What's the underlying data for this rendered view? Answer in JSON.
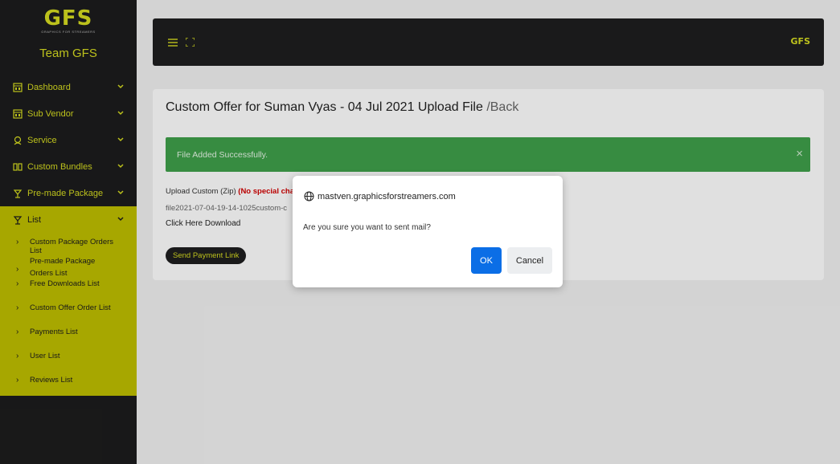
{
  "sidebar": {
    "logo_text": "GFS",
    "logo_subtext": "GRAPHICS FOR STREAMERS",
    "team_name": "Team GFS",
    "menu": [
      {
        "label": "Dashboard",
        "icon": "dashboard-icon"
      },
      {
        "label": "Sub Vendor",
        "icon": "sub-vendor-icon"
      },
      {
        "label": "Service",
        "icon": "service-icon"
      },
      {
        "label": "Custom Bundles",
        "icon": "bundles-icon"
      },
      {
        "label": "Pre-made Package",
        "icon": "package-icon"
      },
      {
        "label": "List",
        "icon": "list-icon"
      }
    ],
    "submenu": [
      "Custom Package Orders List",
      "Pre-made Package Orders List",
      "Free Downloads List",
      "Custom Offer Order List",
      "Payments List",
      "User List",
      "Reviews List"
    ]
  },
  "topbar": {
    "logo_text": "GFS"
  },
  "card": {
    "title": "Custom Offer for Suman Vyas - 04 Jul 2021 Upload File",
    "back_label": "/Back",
    "alert_message": "File Added Successfully.",
    "alert_close": "×",
    "upload_label": "Upload Custom (Zip)",
    "upload_warning": "(No special char",
    "file_name": "file2021-07-04-19-14-1025custom-c",
    "download_link": "Click Here Download",
    "send_button": "Send Payment Link"
  },
  "dialog": {
    "origin": "mastven.graphicsforstreamers.com",
    "message": "Are you sure you want to sent mail?",
    "ok_label": "OK",
    "cancel_label": "Cancel"
  },
  "colors": {
    "accent": "#d7dc20",
    "sidebar_bg": "#1c1c1d",
    "active_bg": "#bfbf00",
    "alert_green": "#3fa04a",
    "ok_blue": "#0b6ee6"
  }
}
